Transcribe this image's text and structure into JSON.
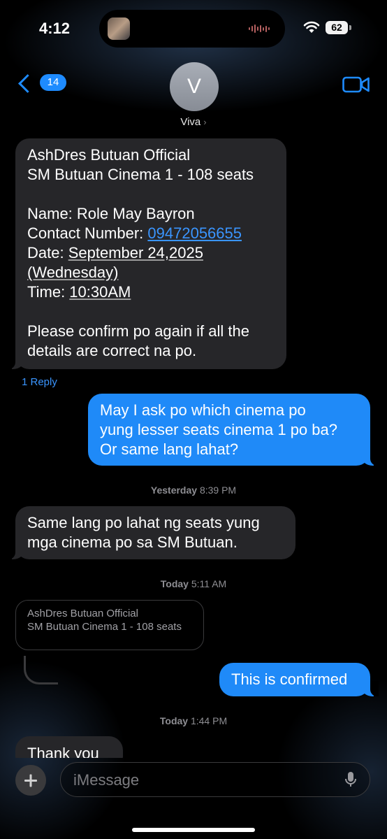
{
  "status_bar": {
    "time": "4:12",
    "battery": "62"
  },
  "header": {
    "back_count": "14",
    "avatar_initial": "V",
    "contact_name": "Viva",
    "contact_chevron": "›"
  },
  "messages": {
    "m1": {
      "l1": "AshDres Butuan Official",
      "l2": "SM Butuan Cinema 1 - 108 seats",
      "name": "Name: Role May Bayron",
      "contact_label": "Contact Number: ",
      "contact_value": "09472056655",
      "date_label": "Date: ",
      "date_value": "September 24,2025",
      "date_value2": "(Wednesday)",
      "time_label": "Time: ",
      "time_value": "10:30AM",
      "confirm_l1": "Please confirm po again if all the",
      "confirm_l2": "details are correct na po."
    },
    "reply_link": "1 Reply",
    "m2": {
      "l1": "May I ask po which cinema po",
      "l2": "yung lesser seats cinema 1 po ba?",
      "l3": "Or same lang lahat?"
    },
    "ts1": {
      "day": "Yesterday",
      "time": "8:39 PM"
    },
    "m3": {
      "l1": "Same lang po lahat ng seats yung",
      "l2": "mga cinema po sa SM Butuan."
    },
    "ts2": {
      "day": "Today",
      "time": "5:11 AM"
    },
    "quote": {
      "l1": "AshDres Butuan Official",
      "l2": "SM Butuan Cinema 1 - 108 seats"
    },
    "m4": {
      "text": "This is confirmed"
    },
    "ts3": {
      "day": "Today",
      "time": "1:44 PM"
    },
    "m5": {
      "text": "Thank you"
    }
  },
  "input": {
    "placeholder": "iMessage"
  },
  "colors": {
    "accent": "#1f8af8",
    "incoming_bubble": "#262629",
    "background": "#000000"
  }
}
